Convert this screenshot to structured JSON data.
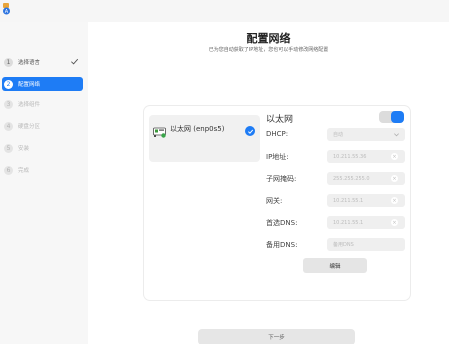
{
  "window": {
    "app_icon": "installer-app-icon"
  },
  "sidebar": {
    "steps": [
      {
        "num": "1",
        "label": "选择语言",
        "state": "done"
      },
      {
        "num": "2",
        "label": "配置网络",
        "state": "active"
      },
      {
        "num": "3",
        "label": "选择组件",
        "state": "pending"
      },
      {
        "num": "4",
        "label": "硬盘分区",
        "state": "pending"
      },
      {
        "num": "5",
        "label": "安装",
        "state": "pending"
      },
      {
        "num": "6",
        "label": "完成",
        "state": "pending"
      }
    ]
  },
  "main": {
    "title": "配置网络",
    "subtitle": "已为您自动获取了IP地址，您也可以手动修改网络配置",
    "interfaces": [
      {
        "name": "以太网 (enp0s5)",
        "selected": true
      }
    ],
    "section_title": "以太网",
    "enabled": true,
    "fields": {
      "dhcp": {
        "label": "DHCP:",
        "value": "自动"
      },
      "ip": {
        "label": "IP地址:",
        "value": "10.211.55.36"
      },
      "mask": {
        "label": "子网掩码:",
        "value": "255.255.255.0"
      },
      "gateway": {
        "label": "网关:",
        "value": "10.211.55.1"
      },
      "dns1": {
        "label": "首选DNS:",
        "value": "10.211.55.1"
      },
      "dns2": {
        "label": "备用DNS:",
        "placeholder": "备用DNS"
      }
    },
    "edit_label": "编辑",
    "next_label": "下一步"
  },
  "colors": {
    "accent": "#1e7cf5",
    "background": "#f6f6f6",
    "field": "#efefef"
  }
}
